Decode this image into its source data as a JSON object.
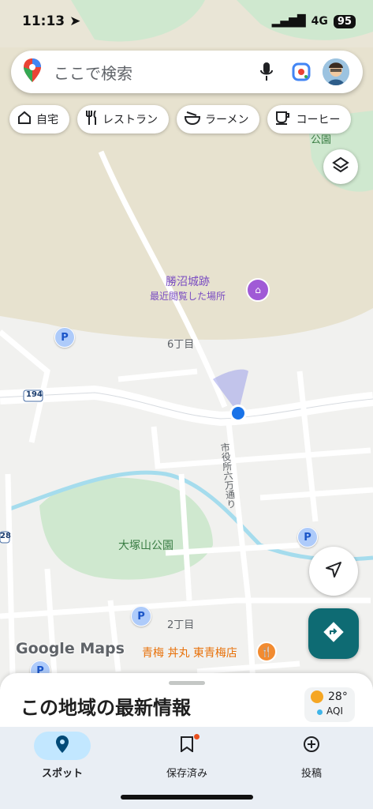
{
  "status": {
    "time": "11:13",
    "network": "4G",
    "battery": "95"
  },
  "search": {
    "placeholder": "ここで検索"
  },
  "chips": [
    {
      "label": "自宅",
      "icon": "home-icon"
    },
    {
      "label": "レストラン",
      "icon": "restaurant-icon"
    },
    {
      "label": "ラーメン",
      "icon": "ramen-icon"
    },
    {
      "label": "コーヒー",
      "icon": "coffee-icon"
    }
  ],
  "map": {
    "poi_name": "勝沼城跡",
    "poi_sub": "最近閲覧した場所",
    "area_6chome": "6丁目",
    "area_2chome": "2丁目",
    "park": "大塚山公園",
    "park_top": "公園",
    "street": "市役所六万通り",
    "route_194": "194",
    "route_28": "28",
    "restaurant": "青梅 丼丸 東青梅店",
    "parking": "P",
    "logo": "Google Maps"
  },
  "sheet": {
    "title": "この地域の最新情報",
    "temperature": "28°",
    "aqi": "AQI"
  },
  "nav": [
    {
      "label": "スポット",
      "icon": "explore-pin-icon"
    },
    {
      "label": "保存済み",
      "icon": "bookmark-icon"
    },
    {
      "label": "投稿",
      "icon": "add-circle-icon"
    }
  ],
  "colors": {
    "accent": "#0e6b73",
    "location": "#1a73e8",
    "park": "#cfe8cf",
    "water": "#a5dced"
  }
}
